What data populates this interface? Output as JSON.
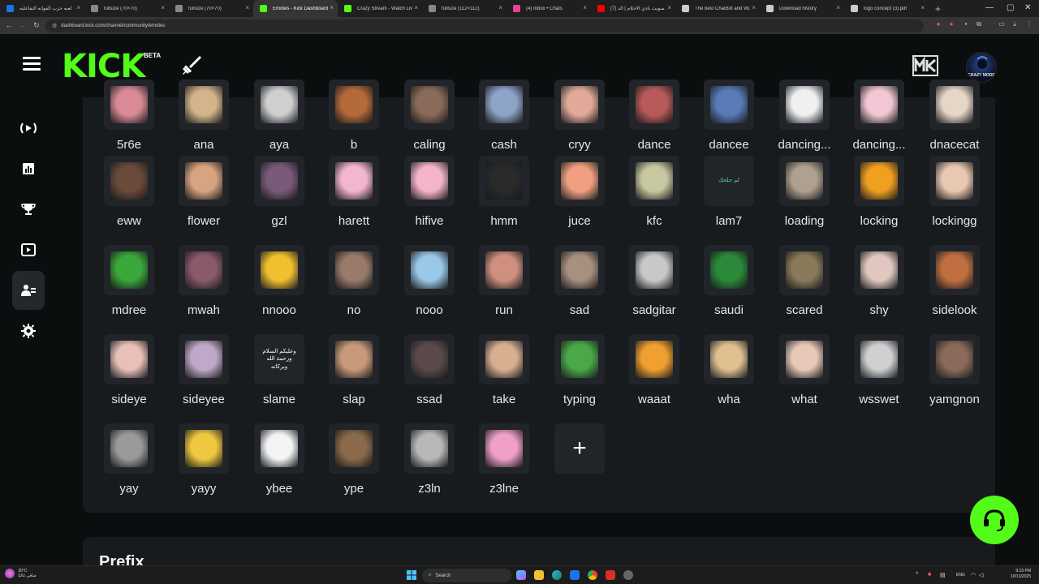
{
  "browser": {
    "tabs": [
      {
        "title": "لعبه حرب القواته التفاعليه",
        "color": "#1a73e8"
      },
      {
        "title": "fullsize (70×70)",
        "color": "#888888"
      },
      {
        "title": "fullsize (70×70)",
        "color": "#888888"
      },
      {
        "title": "Emotes - Kick Dashboard",
        "color": "#53fc18",
        "active": true
      },
      {
        "title": "Crazy Stream - Watch Live...",
        "color": "#53fc18"
      },
      {
        "title": "fullsize (112×112)",
        "color": "#888888"
      },
      {
        "title": "(4) Inbox • Chats",
        "color": "#e84393"
      },
      {
        "title": "(7) سويت نادي الأحلام | الد...",
        "color": "#ff0000"
      },
      {
        "title": "The best ChatBot and Wi...",
        "color": "#cccccc"
      },
      {
        "title": "Download history",
        "color": "#cccccc"
      },
      {
        "title": "logo concept (3).pdf",
        "color": "#cccccc"
      }
    ],
    "url": "dashboard.kick.com/channel/community/emotes"
  },
  "header": {
    "logo_text": "KICK",
    "beta_label": "BETA",
    "avatar_text": "CRAZY MODE"
  },
  "nav": [
    "live-icon",
    "analytics-icon",
    "trophy-icon",
    "clips-icon",
    "community-icon",
    "settings-icon"
  ],
  "emotes": [
    {
      "name": "5r6e",
      "color": "#d98a95"
    },
    {
      "name": "ana",
      "color": "#d4b48a"
    },
    {
      "name": "aya",
      "color": "#cfcfcf"
    },
    {
      "name": "b",
      "color": "#b56a3a"
    },
    {
      "name": "caling",
      "color": "#8a6a5a"
    },
    {
      "name": "cash",
      "color": "#8ea3c8"
    },
    {
      "name": "cryy",
      "color": "#e0a99a"
    },
    {
      "name": "dance",
      "color": "#b85a5a"
    },
    {
      "name": "dancee",
      "color": "#5a7ab8"
    },
    {
      "name": "dancing...",
      "color": "#f0f0f0"
    },
    {
      "name": "dancing...",
      "color": "#f2c7d3"
    },
    {
      "name": "dnacecat",
      "color": "#e6d6c8"
    },
    {
      "name": "eww",
      "color": "#6a4a3a"
    },
    {
      "name": "flower",
      "color": "#d8a380"
    },
    {
      "name": "gzl",
      "color": "#7a5a7a"
    },
    {
      "name": "harett",
      "color": "#f4b5d0"
    },
    {
      "name": "hifive",
      "color": "#f5b5c8"
    },
    {
      "name": "hmm",
      "color": "#2a2a2a"
    },
    {
      "name": "juce",
      "color": "#f0a080"
    },
    {
      "name": "kfc",
      "color": "#c8c8a0"
    },
    {
      "name": "lam7",
      "color": "#1f2326",
      "text": "لم حلجك"
    },
    {
      "name": "loading",
      "color": "#b0a090"
    },
    {
      "name": "locking",
      "color": "#f0a020"
    },
    {
      "name": "lockingg",
      "color": "#e8c8b0"
    },
    {
      "name": "mdree",
      "color": "#3aa83a"
    },
    {
      "name": "mwah",
      "color": "#8a5a6a"
    },
    {
      "name": "nnooo",
      "color": "#f0c030"
    },
    {
      "name": "no",
      "color": "#9a7a6a"
    },
    {
      "name": "nooo",
      "color": "#9ac8e8"
    },
    {
      "name": "run",
      "color": "#d09080"
    },
    {
      "name": "sad",
      "color": "#a89080"
    },
    {
      "name": "sadgitar",
      "color": "#c8c8c8"
    },
    {
      "name": "saudi",
      "color": "#2a8a3a"
    },
    {
      "name": "scared",
      "color": "#8a7a5a"
    },
    {
      "name": "shy",
      "color": "#e0c8c0"
    },
    {
      "name": "sidelook",
      "color": "#c07040"
    },
    {
      "name": "sideye",
      "color": "#e8c0b8"
    },
    {
      "name": "sideyee",
      "color": "#c0a8c8"
    },
    {
      "name": "slame",
      "color": "#1f2326",
      "text": "وعليكم السلام ورحمة الله وبركاته"
    },
    {
      "name": "slap",
      "color": "#c89a7a"
    },
    {
      "name": "ssad",
      "color": "#5a4a4a"
    },
    {
      "name": "take",
      "color": "#d8b090"
    },
    {
      "name": "typing",
      "color": "#4aa84a"
    },
    {
      "name": "waaat",
      "color": "#f0a030"
    },
    {
      "name": "wha",
      "color": "#e0c090"
    },
    {
      "name": "what",
      "color": "#e8c8b8"
    },
    {
      "name": "wsswet",
      "color": "#d0d0d0"
    },
    {
      "name": "yamgnon",
      "color": "#8a6a5a"
    },
    {
      "name": "yay",
      "color": "#9a9a9a"
    },
    {
      "name": "yayy",
      "color": "#f0c840"
    },
    {
      "name": "ybee",
      "color": "#f4f4f4"
    },
    {
      "name": "ype",
      "color": "#8a6a4a"
    },
    {
      "name": "z3ln",
      "color": "#b8b8b8"
    },
    {
      "name": "z3lne",
      "color": "#f0a0c8"
    }
  ],
  "add_label": "+",
  "prefix": {
    "title": "Prefix"
  },
  "taskbar": {
    "weather_temp": "30°C",
    "weather_desc": "صافي غالبًا",
    "search_label": "Search",
    "lang": "ENG",
    "time": "9:15 PM",
    "date": "10/13/2025"
  }
}
